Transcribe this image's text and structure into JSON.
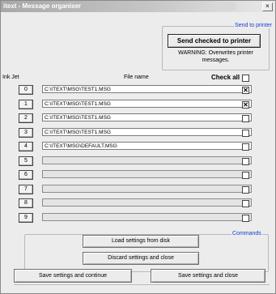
{
  "window": {
    "title": "itext - Message organiser",
    "close_glyph": "×"
  },
  "send_group": {
    "label": "Send to printer",
    "button_label": "Send checked to printer",
    "warning_line1": "WARNING: Overwrites printer",
    "warning_line2": "messages."
  },
  "headers": {
    "ink_jet": "Ink Jet",
    "file_name": "File name",
    "check_all": "Check all"
  },
  "check_all_checked": false,
  "rows": [
    {
      "num": "0",
      "file": "C:\\ITEXT\\MSG\\TEST1.MSG",
      "checked": true
    },
    {
      "num": "1",
      "file": "C:\\ITEXT\\MSG\\TEST1.MSG",
      "checked": true
    },
    {
      "num": "2",
      "file": "C:\\ITEXT\\MSG\\TEST1.MSG",
      "checked": false
    },
    {
      "num": "3",
      "file": "C:\\ITEXT\\MSG\\TEST1.MSG",
      "checked": false
    },
    {
      "num": "4",
      "file": "C:\\ITEXT\\MSG\\DEFAULT.MSG",
      "checked": false
    },
    {
      "num": "5",
      "file": "",
      "checked": false
    },
    {
      "num": "6",
      "file": "",
      "checked": false
    },
    {
      "num": "7",
      "file": "",
      "checked": false
    },
    {
      "num": "8",
      "file": "",
      "checked": false
    },
    {
      "num": "9",
      "file": "",
      "checked": false
    }
  ],
  "commands": {
    "label": "Commands",
    "load": "Load settings from disk",
    "discard": "Discard settings and close",
    "save_continue": "Save settings and continue",
    "save_close": "Save settings and close"
  },
  "colors": {
    "group_label": "#1a3bd1",
    "window_bg": "#ececec"
  }
}
